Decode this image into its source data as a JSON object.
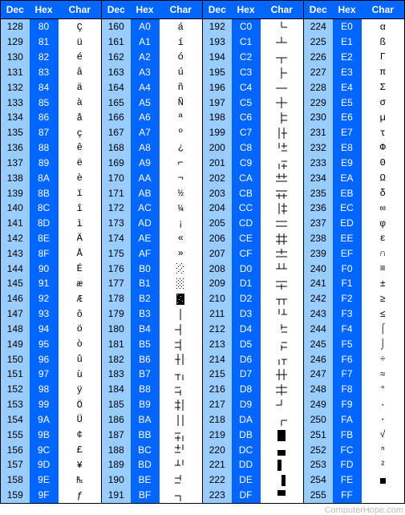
{
  "headers": [
    "Dec",
    "Hex",
    "Char"
  ],
  "groups": 4,
  "credit": "ComputerHope.com",
  "rows": [
    {
      "dec": 128,
      "hex": "80",
      "char": "Ç"
    },
    {
      "dec": 129,
      "hex": "81",
      "char": "ü"
    },
    {
      "dec": 130,
      "hex": "82",
      "char": "é"
    },
    {
      "dec": 131,
      "hex": "83",
      "char": "â"
    },
    {
      "dec": 132,
      "hex": "84",
      "char": "ä"
    },
    {
      "dec": 133,
      "hex": "85",
      "char": "à"
    },
    {
      "dec": 134,
      "hex": "86",
      "char": "å"
    },
    {
      "dec": 135,
      "hex": "87",
      "char": "ç"
    },
    {
      "dec": 136,
      "hex": "88",
      "char": "ê"
    },
    {
      "dec": 137,
      "hex": "89",
      "char": "ë"
    },
    {
      "dec": 138,
      "hex": "8A",
      "char": "è"
    },
    {
      "dec": 139,
      "hex": "8B",
      "char": "ï"
    },
    {
      "dec": 140,
      "hex": "8C",
      "char": "î"
    },
    {
      "dec": 141,
      "hex": "8D",
      "char": "ì"
    },
    {
      "dec": 142,
      "hex": "8E",
      "char": "Ä"
    },
    {
      "dec": 143,
      "hex": "8F",
      "char": "Å"
    },
    {
      "dec": 144,
      "hex": "90",
      "char": "É"
    },
    {
      "dec": 145,
      "hex": "91",
      "char": "æ"
    },
    {
      "dec": 146,
      "hex": "92",
      "char": "Æ"
    },
    {
      "dec": 147,
      "hex": "93",
      "char": "ô"
    },
    {
      "dec": 148,
      "hex": "94",
      "char": "ö"
    },
    {
      "dec": 149,
      "hex": "95",
      "char": "ò"
    },
    {
      "dec": 150,
      "hex": "96",
      "char": "û"
    },
    {
      "dec": 151,
      "hex": "97",
      "char": "ù"
    },
    {
      "dec": 152,
      "hex": "98",
      "char": "ÿ"
    },
    {
      "dec": 153,
      "hex": "99",
      "char": "Ö"
    },
    {
      "dec": 154,
      "hex": "9A",
      "char": "Ü"
    },
    {
      "dec": 155,
      "hex": "9B",
      "char": "¢"
    },
    {
      "dec": 156,
      "hex": "9C",
      "char": "£"
    },
    {
      "dec": 157,
      "hex": "9D",
      "char": "¥"
    },
    {
      "dec": 158,
      "hex": "9E",
      "char": "₧"
    },
    {
      "dec": 159,
      "hex": "9F",
      "char": "ƒ"
    },
    {
      "dec": 160,
      "hex": "A0",
      "char": "á"
    },
    {
      "dec": 161,
      "hex": "A1",
      "char": "í"
    },
    {
      "dec": 162,
      "hex": "A2",
      "char": "ó"
    },
    {
      "dec": 163,
      "hex": "A3",
      "char": "ú"
    },
    {
      "dec": 164,
      "hex": "A4",
      "char": "ñ"
    },
    {
      "dec": 165,
      "hex": "A5",
      "char": "Ñ"
    },
    {
      "dec": 166,
      "hex": "A6",
      "char": "ª"
    },
    {
      "dec": 167,
      "hex": "A7",
      "char": "º"
    },
    {
      "dec": 168,
      "hex": "A8",
      "char": "¿"
    },
    {
      "dec": 169,
      "hex": "A9",
      "char": "⌐"
    },
    {
      "dec": 170,
      "hex": "AA",
      "char": "¬"
    },
    {
      "dec": 171,
      "hex": "AB",
      "char": "½"
    },
    {
      "dec": 172,
      "hex": "AC",
      "char": "¼"
    },
    {
      "dec": 173,
      "hex": "AD",
      "char": "¡"
    },
    {
      "dec": 174,
      "hex": "AE",
      "char": "«"
    },
    {
      "dec": 175,
      "hex": "AF",
      "char": "»"
    },
    {
      "dec": 176,
      "hex": "B0",
      "char": "░"
    },
    {
      "dec": 177,
      "hex": "B1",
      "char": "▒"
    },
    {
      "dec": 178,
      "hex": "B2",
      "char": "▓"
    },
    {
      "dec": 179,
      "hex": "B3",
      "char": "│"
    },
    {
      "dec": 180,
      "hex": "B4",
      "char": "┤"
    },
    {
      "dec": 181,
      "hex": "B5",
      "char": "╡"
    },
    {
      "dec": 182,
      "hex": "B6",
      "char": "╢"
    },
    {
      "dec": 183,
      "hex": "B7",
      "char": "╖"
    },
    {
      "dec": 184,
      "hex": "B8",
      "char": "╕"
    },
    {
      "dec": 185,
      "hex": "B9",
      "char": "╣"
    },
    {
      "dec": 186,
      "hex": "BA",
      "char": "║"
    },
    {
      "dec": 187,
      "hex": "BB",
      "char": "╗"
    },
    {
      "dec": 188,
      "hex": "BC",
      "char": "╝"
    },
    {
      "dec": 189,
      "hex": "BD",
      "char": "╜"
    },
    {
      "dec": 190,
      "hex": "BE",
      "char": "╛"
    },
    {
      "dec": 191,
      "hex": "BF",
      "char": "┐"
    },
    {
      "dec": 192,
      "hex": "C0",
      "char": "└"
    },
    {
      "dec": 193,
      "hex": "C1",
      "char": "┴"
    },
    {
      "dec": 194,
      "hex": "C2",
      "char": "┬"
    },
    {
      "dec": 195,
      "hex": "C3",
      "char": "├"
    },
    {
      "dec": 196,
      "hex": "C4",
      "char": "─"
    },
    {
      "dec": 197,
      "hex": "C5",
      "char": "┼"
    },
    {
      "dec": 198,
      "hex": "C6",
      "char": "╞"
    },
    {
      "dec": 199,
      "hex": "C7",
      "char": "╟"
    },
    {
      "dec": 200,
      "hex": "C8",
      "char": "╚"
    },
    {
      "dec": 201,
      "hex": "C9",
      "char": "╔"
    },
    {
      "dec": 202,
      "hex": "CA",
      "char": "╩"
    },
    {
      "dec": 203,
      "hex": "CB",
      "char": "╦"
    },
    {
      "dec": 204,
      "hex": "CC",
      "char": "╠"
    },
    {
      "dec": 205,
      "hex": "CD",
      "char": "═"
    },
    {
      "dec": 206,
      "hex": "CE",
      "char": "╬"
    },
    {
      "dec": 207,
      "hex": "CF",
      "char": "╧"
    },
    {
      "dec": 208,
      "hex": "D0",
      "char": "╨"
    },
    {
      "dec": 209,
      "hex": "D1",
      "char": "╤"
    },
    {
      "dec": 210,
      "hex": "D2",
      "char": "╥"
    },
    {
      "dec": 211,
      "hex": "D3",
      "char": "╙"
    },
    {
      "dec": 212,
      "hex": "D4",
      "char": "╘"
    },
    {
      "dec": 213,
      "hex": "D5",
      "char": "╒"
    },
    {
      "dec": 214,
      "hex": "D6",
      "char": "╓"
    },
    {
      "dec": 215,
      "hex": "D7",
      "char": "╫"
    },
    {
      "dec": 216,
      "hex": "D8",
      "char": "╪"
    },
    {
      "dec": 217,
      "hex": "D9",
      "char": "┘"
    },
    {
      "dec": 218,
      "hex": "DA",
      "char": "┌"
    },
    {
      "dec": 219,
      "hex": "DB",
      "char": "█"
    },
    {
      "dec": 220,
      "hex": "DC",
      "char": "▄"
    },
    {
      "dec": 221,
      "hex": "DD",
      "char": "▌"
    },
    {
      "dec": 222,
      "hex": "DE",
      "char": "▐"
    },
    {
      "dec": 223,
      "hex": "DF",
      "char": "▀"
    },
    {
      "dec": 224,
      "hex": "E0",
      "char": "α"
    },
    {
      "dec": 225,
      "hex": "E1",
      "char": "ß"
    },
    {
      "dec": 226,
      "hex": "E2",
      "char": "Γ"
    },
    {
      "dec": 227,
      "hex": "E3",
      "char": "π"
    },
    {
      "dec": 228,
      "hex": "E4",
      "char": "Σ"
    },
    {
      "dec": 229,
      "hex": "E5",
      "char": "σ"
    },
    {
      "dec": 230,
      "hex": "E6",
      "char": "µ"
    },
    {
      "dec": 231,
      "hex": "E7",
      "char": "τ"
    },
    {
      "dec": 232,
      "hex": "E8",
      "char": "Φ"
    },
    {
      "dec": 233,
      "hex": "E9",
      "char": "Θ"
    },
    {
      "dec": 234,
      "hex": "EA",
      "char": "Ω"
    },
    {
      "dec": 235,
      "hex": "EB",
      "char": "δ"
    },
    {
      "dec": 236,
      "hex": "EC",
      "char": "∞"
    },
    {
      "dec": 237,
      "hex": "ED",
      "char": "φ"
    },
    {
      "dec": 238,
      "hex": "EE",
      "char": "ε"
    },
    {
      "dec": 239,
      "hex": "EF",
      "char": "∩"
    },
    {
      "dec": 240,
      "hex": "F0",
      "char": "≡"
    },
    {
      "dec": 241,
      "hex": "F1",
      "char": "±"
    },
    {
      "dec": 242,
      "hex": "F2",
      "char": "≥"
    },
    {
      "dec": 243,
      "hex": "F3",
      "char": "≤"
    },
    {
      "dec": 244,
      "hex": "F4",
      "char": "⌠"
    },
    {
      "dec": 245,
      "hex": "F5",
      "char": "⌡"
    },
    {
      "dec": 246,
      "hex": "F6",
      "char": "÷"
    },
    {
      "dec": 247,
      "hex": "F7",
      "char": "≈"
    },
    {
      "dec": 248,
      "hex": "F8",
      "char": "°"
    },
    {
      "dec": 249,
      "hex": "F9",
      "char": "∙"
    },
    {
      "dec": 250,
      "hex": "FA",
      "char": "·"
    },
    {
      "dec": 251,
      "hex": "FB",
      "char": "√"
    },
    {
      "dec": 252,
      "hex": "FC",
      "char": "ⁿ"
    },
    {
      "dec": 253,
      "hex": "FD",
      "char": "²"
    },
    {
      "dec": 254,
      "hex": "FE",
      "char": "■"
    },
    {
      "dec": 255,
      "hex": "FF",
      "char": " "
    }
  ]
}
